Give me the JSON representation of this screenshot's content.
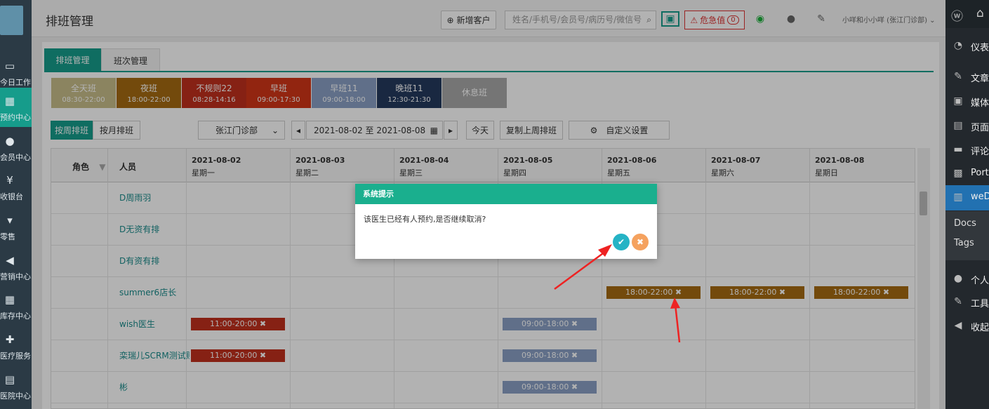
{
  "left_nav": [
    {
      "label": "今日工作",
      "icon": "laptop-icon"
    },
    {
      "label": "预约中心",
      "icon": "calendar-icon"
    },
    {
      "label": "会员中心",
      "icon": "users-icon"
    },
    {
      "label": "收银台",
      "icon": "yen-icon"
    },
    {
      "label": "零售",
      "icon": "cart-icon"
    },
    {
      "label": "营销中心",
      "icon": "megaphone-icon"
    },
    {
      "label": "库存中心",
      "icon": "grid-icon"
    },
    {
      "label": "医疗服务",
      "icon": "medkit-icon"
    },
    {
      "label": "医院中心",
      "icon": "hospital-icon"
    }
  ],
  "topbar": {
    "title": "排班管理",
    "new_customer": "新增客户",
    "search_placeholder": "姓名/手机号/会员号/病历号/微信号",
    "danger_label": "危急值",
    "danger_count": "0",
    "user": "小咩和小小咩 (张江门诊部)"
  },
  "tabs": [
    "排班管理",
    "班次管理"
  ],
  "shifts": [
    {
      "name": "全天班",
      "time": "08:30-22:00",
      "color": "#c7bd8a"
    },
    {
      "name": "夜班",
      "time": "18:00-22:00",
      "color": "#a56b12"
    },
    {
      "name": "不规则22",
      "time": "08:28-14:16",
      "color": "#c0301e"
    },
    {
      "name": "早班",
      "time": "09:00-17:30",
      "color": "#d13617"
    },
    {
      "name": "早班11",
      "time": "09:00-18:00",
      "color": "#8aa0c4"
    },
    {
      "name": "晚班11",
      "time": "12:30-21:30",
      "color": "#243a5e"
    },
    {
      "name": "休息班",
      "time": "",
      "color": "#a8a8a8"
    }
  ],
  "toolbar": {
    "by_week": "按周排班",
    "by_month": "按月排班",
    "clinic": "张江门诊部",
    "date_range": "2021-08-02 至 2021-08-08",
    "today": "今天",
    "copy_last": "复制上周排班",
    "custom": "自定义设置"
  },
  "table": {
    "col_role": "角色",
    "col_person": "人员",
    "days": [
      {
        "date": "2021-08-02",
        "weekday": "星期一"
      },
      {
        "date": "2021-08-03",
        "weekday": "星期二"
      },
      {
        "date": "2021-08-04",
        "weekday": "星期三"
      },
      {
        "date": "2021-08-05",
        "weekday": "星期四"
      },
      {
        "date": "2021-08-06",
        "weekday": "星期五"
      },
      {
        "date": "2021-08-07",
        "weekday": "星期六"
      },
      {
        "date": "2021-08-08",
        "weekday": "星期日"
      }
    ],
    "rows": [
      {
        "name": "D周雨羽",
        "cells": [
          "",
          "",
          "",
          "",
          "",
          "",
          ""
        ]
      },
      {
        "name": "D无资有排",
        "cells": [
          "",
          "",
          "",
          "",
          "",
          "",
          ""
        ]
      },
      {
        "name": "D有资有排",
        "cells": [
          "",
          "",
          "",
          "",
          "",
          "",
          ""
        ]
      },
      {
        "name": "summer6店长",
        "cells": [
          "",
          "",
          "",
          "",
          "18:00-22:00",
          "18:00-22:00",
          "18:00-22:00"
        ]
      },
      {
        "name": "wish医生",
        "cells": [
          "11:00-20:00",
          "",
          "",
          "09:00-18:00",
          "",
          "",
          ""
        ]
      },
      {
        "name": "栾瑞儿SCRM测试账",
        "cells": [
          "11:00-20:00",
          "",
          "",
          "09:00-18:00",
          "",
          "",
          ""
        ]
      },
      {
        "name": "彬",
        "cells": [
          "",
          "",
          "",
          "09:00-18:00",
          "",
          "",
          ""
        ]
      }
    ]
  },
  "dialog": {
    "title": "系统提示",
    "message": "该医生已经有人预约,是否继续取消?"
  },
  "wp_menu": [
    {
      "label": "仪表",
      "icon": "dashboard-icon"
    },
    {
      "label": "文章",
      "icon": "pin-icon"
    },
    {
      "label": "媒体",
      "icon": "media-icon"
    },
    {
      "label": "页面",
      "icon": "pages-icon"
    },
    {
      "label": "评论",
      "icon": "comment-icon"
    },
    {
      "label": "Port",
      "icon": "portfolio-icon"
    },
    {
      "label": "weD",
      "icon": "doc-icon"
    }
  ],
  "wp_sub": [
    "Docs",
    "Tags"
  ],
  "wp_menu2": [
    {
      "label": "个人",
      "icon": "person-icon"
    },
    {
      "label": "工具",
      "icon": "wrench-icon"
    },
    {
      "label": "收起",
      "icon": "collapse-icon"
    }
  ]
}
